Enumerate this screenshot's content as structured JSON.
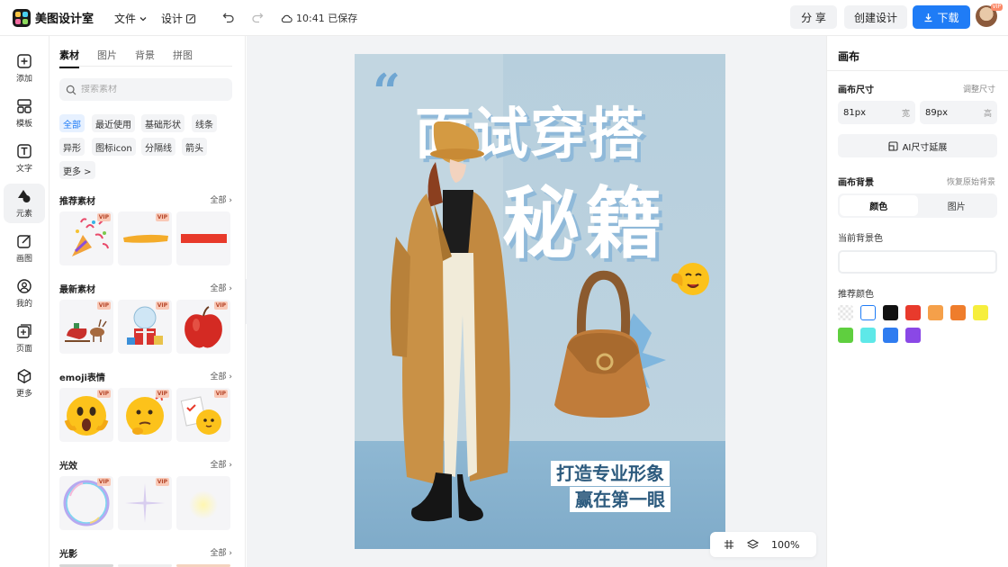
{
  "app": {
    "name": "美图设计室"
  },
  "topbar": {
    "file_label": "文件",
    "design_label": "设计",
    "saved_status": "10:41 已保存",
    "share_label": "分 享",
    "create_label": "创建设计",
    "download_label": "下载",
    "avatar_badge": "VIP"
  },
  "rail": {
    "items": [
      {
        "label": "添加",
        "icon": "plus-square-icon"
      },
      {
        "label": "模板",
        "icon": "template-icon"
      },
      {
        "label": "文字",
        "icon": "text-icon"
      },
      {
        "label": "元素",
        "icon": "element-icon",
        "active": true
      },
      {
        "label": "画图",
        "icon": "draw-icon"
      },
      {
        "label": "我的",
        "icon": "user-icon"
      },
      {
        "label": "页面",
        "icon": "page-add-icon"
      },
      {
        "label": "更多",
        "icon": "cube-icon"
      }
    ]
  },
  "panel": {
    "tabs": [
      "素材",
      "图片",
      "背景",
      "拼图"
    ],
    "search_placeholder": "搜索素材",
    "filters": [
      "全部",
      "最近使用",
      "基础形状",
      "线条",
      "异形",
      "图标icon",
      "分隔线",
      "箭头",
      "更多 >"
    ],
    "see_all": "全部",
    "vip": "VIP",
    "sections": [
      {
        "title": "推荐素材"
      },
      {
        "title": "最新素材"
      },
      {
        "title": "emoji表情"
      },
      {
        "title": "光效"
      },
      {
        "title": "光影"
      }
    ]
  },
  "artboard": {
    "quote": "“",
    "headline_line1": "面试穿搭",
    "headline_line2": "秘籍",
    "sub_line1": "打造专业形象",
    "sub_line2": "赢在第一眼"
  },
  "statusbar": {
    "zoom": "100%"
  },
  "props": {
    "title": "画布",
    "size_label": "画布尺寸",
    "adjust_size": "调整尺寸",
    "width_value": "81px",
    "width_unit": "宽",
    "height_value": "89px",
    "height_unit": "高",
    "ai_button": "AI尺寸延展",
    "bg_label": "画布背景",
    "restore_bg": "恢复原始背景",
    "bg_tabs": [
      "颜色",
      "图片"
    ],
    "current_bg_label": "当前背景色",
    "recommended_label": "推荐颜色",
    "swatches": [
      "transparent",
      "#ffffff",
      "#111111",
      "#e83a2c",
      "#f5a04a",
      "#ef7d2c",
      "#f6ee3d",
      "#5fcf3f",
      "#5ee8e8",
      "#2f7cf0",
      "#8a48e6"
    ]
  },
  "colors": {
    "accent": "#1f7cf6"
  }
}
